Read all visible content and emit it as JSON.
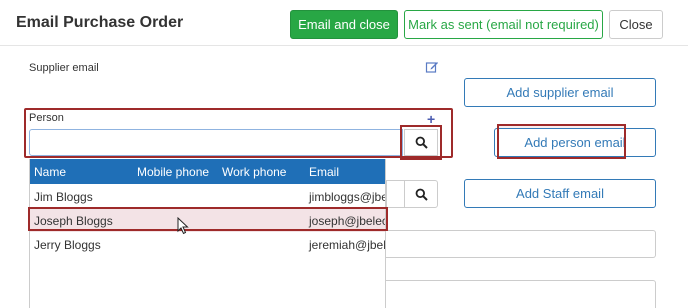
{
  "dialog": {
    "title": "Email Purchase Order",
    "email_close_label": "Email and close",
    "mark_sent_label": "Mark as sent (email not required)",
    "close_label": "Close"
  },
  "form": {
    "supplier_email_label": "Supplier email",
    "add_supplier_email_label": "Add supplier email",
    "person_label": "Person",
    "person_input_value": "",
    "add_person_email_label": "Add person email",
    "add_staff_email_label": "Add Staff email"
  },
  "person_dropdown": {
    "columns": [
      "Name",
      "Mobile phone",
      "Work phone",
      "Email"
    ],
    "rows": [
      {
        "name": "Jim Bloggs",
        "mobile": "",
        "work": "",
        "email": "jimbloggs@jbele"
      },
      {
        "name": "Joseph Bloggs",
        "mobile": "",
        "work": "",
        "email": "joseph@jbelect"
      },
      {
        "name": "Jerry Bloggs",
        "mobile": "",
        "work": "",
        "email": "jeremiah@jbele"
      }
    ]
  },
  "icons": {
    "edit": "edit-icon",
    "plus": "plus-icon",
    "search": "search-icon",
    "cursor": "mouse-cursor-icon"
  },
  "colors": {
    "success": "#28a745",
    "primary": "#337ab7",
    "table_header": "#1f6fb7",
    "highlight": "#9e2a2a"
  }
}
